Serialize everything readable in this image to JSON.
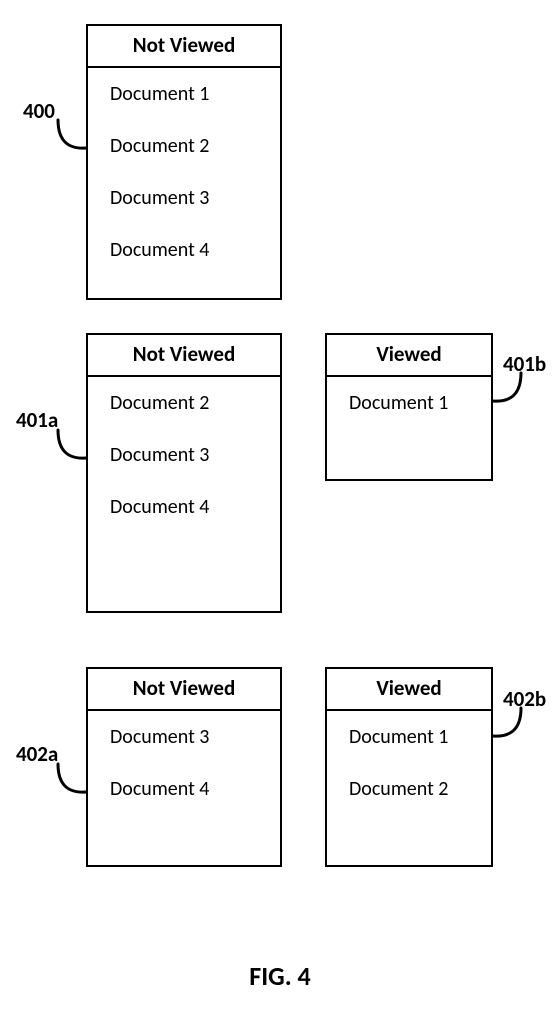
{
  "figure": {
    "caption": "FIG. 4"
  },
  "refs": {
    "r400": "400",
    "r401a": "401a",
    "r401b": "401b",
    "r402a": "402a",
    "r402b": "402b"
  },
  "boxes": {
    "b400": {
      "title": "Not Viewed",
      "items": [
        "Document 1",
        "Document 2",
        "Document 3",
        "Document 4"
      ]
    },
    "b401a": {
      "title": "Not Viewed",
      "items": [
        "Document 2",
        "Document 3",
        "Document 4"
      ]
    },
    "b401b": {
      "title": "Viewed",
      "items": [
        "Document 1"
      ]
    },
    "b402a": {
      "title": "Not Viewed",
      "items": [
        "Document 3",
        "Document 4"
      ]
    },
    "b402b": {
      "title": "Viewed",
      "items": [
        "Document 1",
        "Document 2"
      ]
    }
  }
}
